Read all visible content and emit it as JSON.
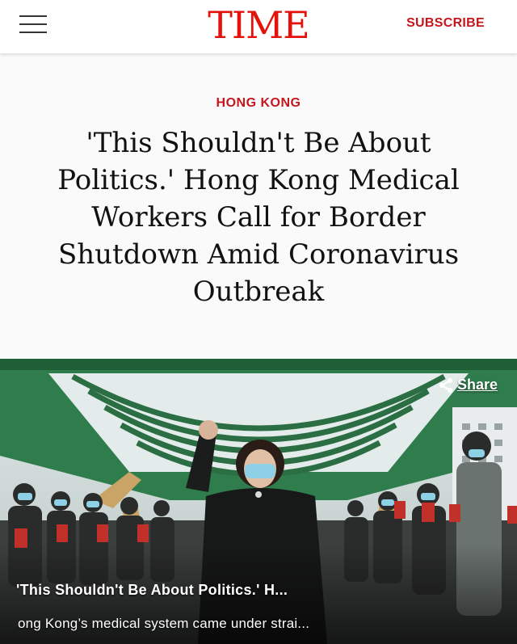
{
  "header": {
    "logo": "TIME",
    "subscribe_label": "SUBSCRIBE"
  },
  "article": {
    "category": "HONG KONG",
    "headline": "'This Shouldn't Be About Politics.' Hong Kong Medical Workers Call for Border Shutdown Amid Coronavirus Outbreak"
  },
  "media": {
    "share_label": "Share",
    "caption_title": "'This Shouldn't Be About Politics.' H...",
    "caption_text": "ong Kong’s medical system came under strai..."
  },
  "icons": {
    "menu": "hamburger-menu-icon",
    "share": "share-icon"
  },
  "colors": {
    "brand_red": "#e3120b",
    "accent_red": "#c4161c",
    "canopy_green": "#2f7d4d"
  }
}
